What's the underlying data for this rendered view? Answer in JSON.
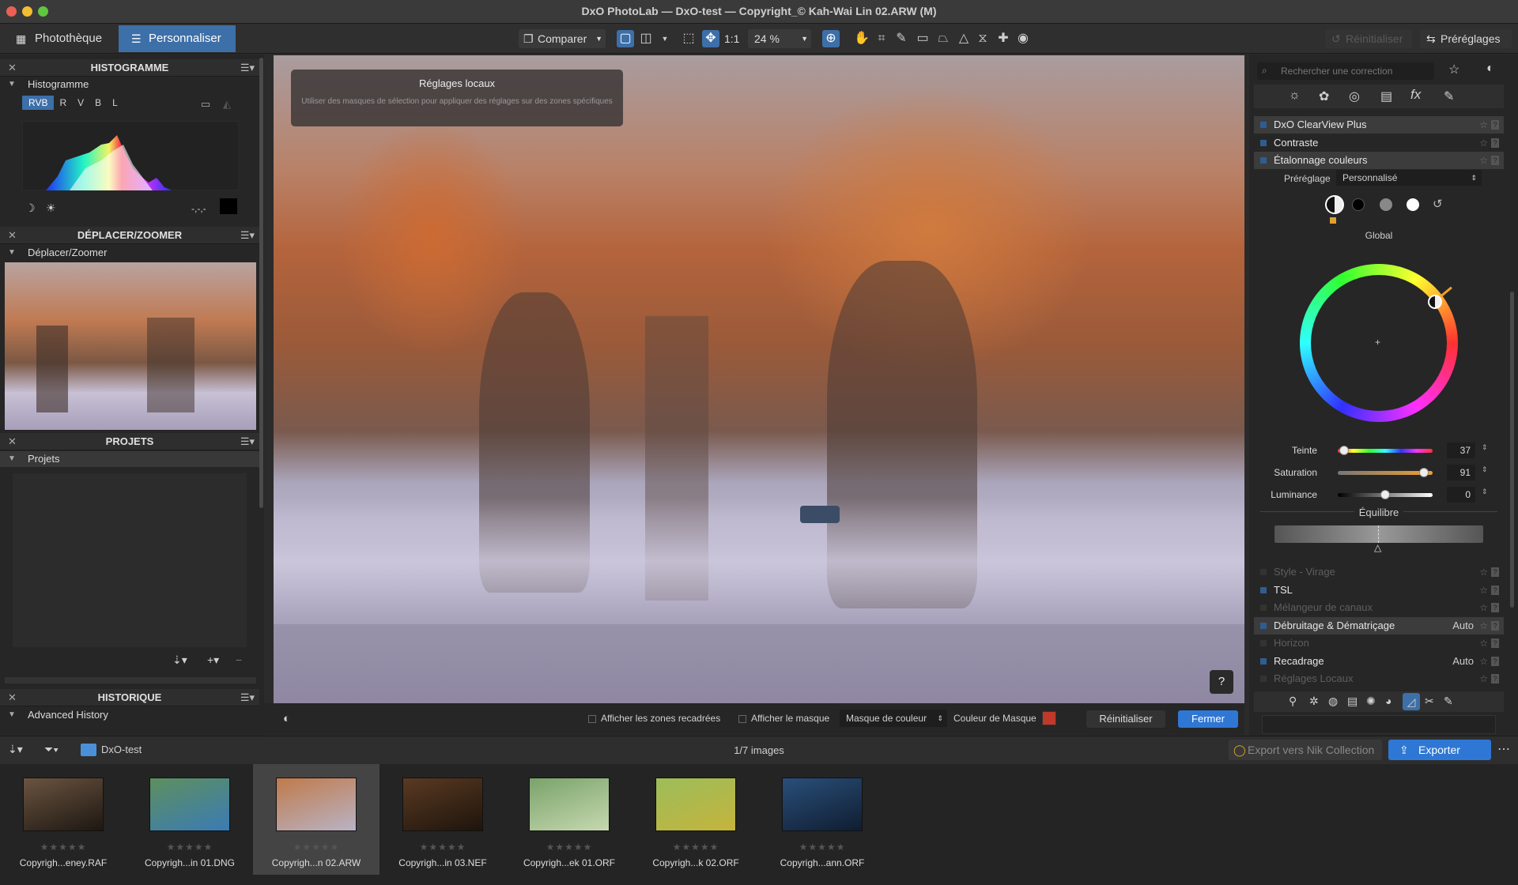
{
  "window": {
    "title": "DxO PhotoLab — DxO-test — Copyright_© Kah-Wai Lin 02.ARW (M)"
  },
  "tabs": [
    {
      "label": "Photothèque"
    },
    {
      "label": "Personnaliser"
    }
  ],
  "toolbar": {
    "compare": "Comparer",
    "ratio": "1:1",
    "zoom": "24 %",
    "reset": "Réinitialiser",
    "presets": "Préréglages"
  },
  "left": {
    "histogram": {
      "title": "HISTOGRAMME",
      "sub": "Histogramme",
      "channels": [
        "RVB",
        "R",
        "V",
        "B",
        "L"
      ],
      "readout": "-,-,-"
    },
    "navigator": {
      "title": "DÉPLACER/ZOOMER",
      "sub": "Déplacer/Zoomer"
    },
    "projects": {
      "title": "PROJETS",
      "sub": "Projets"
    },
    "history": {
      "title": "HISTORIQUE",
      "sub": "Advanced History"
    }
  },
  "viewer": {
    "tooltip_title": "Réglages locaux",
    "tooltip_text": "Utiliser des masques de sélection pour appliquer des réglages sur des zones spécifiques",
    "help": "?"
  },
  "bottom": {
    "show_crop": "Afficher les zones recadrées",
    "show_mask": "Afficher le masque",
    "mask_type": "Masque de couleur",
    "mask_color": "Couleur de Masque",
    "mask_color_value": "#c0392b",
    "reset": "Réinitialiser",
    "close": "Fermer"
  },
  "right": {
    "search_placeholder": "Rechercher une correction",
    "rows_top": [
      {
        "label": "DxO ClearView Plus",
        "state": "highlight"
      },
      {
        "label": "Contraste",
        "state": "normal"
      },
      {
        "label": "Étalonnage couleurs",
        "state": "highlight"
      }
    ],
    "preset_label": "Préréglage",
    "preset_value": "Personnalisé",
    "wheel_label": "Global",
    "sliders": [
      {
        "label": "Teinte",
        "value": "37",
        "fraction": 0.07
      },
      {
        "label": "Saturation",
        "value": "91",
        "fraction": 0.91
      },
      {
        "label": "Luminance",
        "value": "0",
        "fraction": 0.5
      }
    ],
    "balance_label": "Équilibre",
    "rows_bottom": [
      {
        "label": "Style - Virage",
        "auto": "",
        "state": "dim"
      },
      {
        "label": "TSL",
        "auto": "",
        "state": "normal"
      },
      {
        "label": "Mélangeur de canaux",
        "auto": "",
        "state": "dim"
      },
      {
        "label": "Débruitage & Dématriçage",
        "auto": "Auto",
        "state": "highlight"
      },
      {
        "label": "Horizon",
        "auto": "",
        "state": "dim"
      },
      {
        "label": "Recadrage",
        "auto": "Auto",
        "state": "normal"
      },
      {
        "label": "Réglages Locaux",
        "auto": "",
        "state": "dim"
      }
    ]
  },
  "filmstrip": {
    "folder": "DxO-test",
    "count": "1/7 images",
    "nik": "Export vers Nik Collection",
    "export": "Exporter",
    "thumbs": [
      {
        "name": "Copyrigh...eney.RAF",
        "c1": "#6b5440",
        "c2": "#1d1712",
        "selected": false
      },
      {
        "name": "Copyrigh...in 01.DNG",
        "c1": "#5e8f5e",
        "c2": "#3a7bb5",
        "selected": false
      },
      {
        "name": "Copyrigh...n 02.ARW",
        "c1": "#c07a4a",
        "c2": "#b9b3c6",
        "selected": true
      },
      {
        "name": "Copyrigh...in 03.NEF",
        "c1": "#5a3a22",
        "c2": "#1e140c",
        "selected": false
      },
      {
        "name": "Copyrigh...ek 01.ORF",
        "c1": "#7aa36a",
        "c2": "#c6d8b0",
        "selected": false
      },
      {
        "name": "Copyrigh...k 02.ORF",
        "c1": "#9cbd5a",
        "c2": "#c5b43c",
        "selected": false
      },
      {
        "name": "Copyrigh...ann.ORF",
        "c1": "#2a4f7a",
        "c2": "#0f1d30",
        "selected": false
      }
    ]
  }
}
